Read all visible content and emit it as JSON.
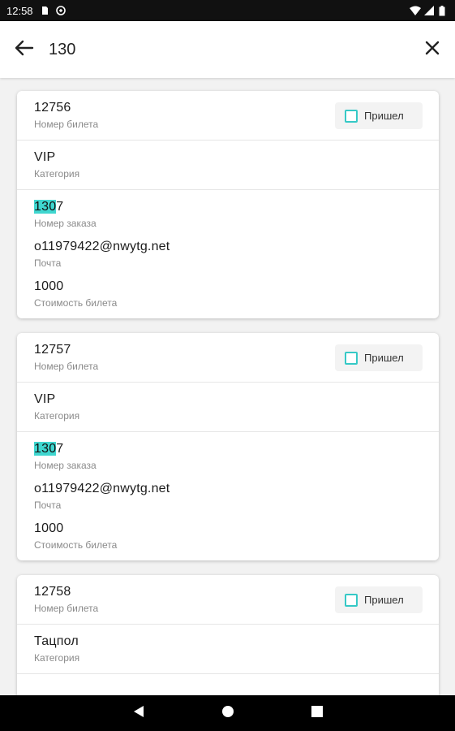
{
  "status_bar": {
    "time": "12:58",
    "left_icons": [
      "sd-card-icon",
      "sync-icon"
    ],
    "right_icons": [
      "wifi-icon",
      "signal-icon",
      "battery-icon"
    ]
  },
  "search": {
    "query": "130",
    "back_icon": "arrow-left-icon",
    "clear_icon": "close-icon"
  },
  "colors": {
    "highlight": "#3fd6cf",
    "checkbox_border": "#36c9c6"
  },
  "cards": [
    {
      "ticket_number": "12756",
      "ticket_number_label": "Номер билета",
      "arrived_label": "Пришел",
      "category": "VIP",
      "category_label": "Категория",
      "order_highlight": "130",
      "order_rest": "7",
      "order_label": "Номер заказа",
      "email": "o11979422@nwytg.net",
      "email_label": "Почта",
      "price": "1000",
      "price_label": "Стоимость билета"
    },
    {
      "ticket_number": "12757",
      "ticket_number_label": "Номер билета",
      "arrived_label": "Пришел",
      "category": "VIP",
      "category_label": "Категория",
      "order_highlight": "130",
      "order_rest": "7",
      "order_label": "Номер заказа",
      "email": "o11979422@nwytg.net",
      "email_label": "Почта",
      "price": "1000",
      "price_label": "Стоимость билета"
    },
    {
      "ticket_number": "12758",
      "ticket_number_label": "Номер билета",
      "arrived_label": "Пришел",
      "category": "Тацпол",
      "category_label": "Категория"
    }
  ],
  "nav": {
    "back_icon": "nav-back-icon",
    "home_icon": "nav-home-icon",
    "recents_icon": "nav-recents-icon"
  }
}
